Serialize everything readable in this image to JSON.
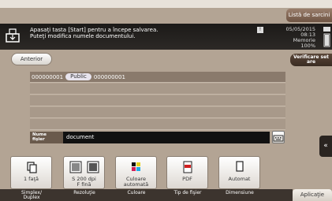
{
  "header": {
    "jobs_tab_label": "Listă de sarcini",
    "message_line1": "Apasaţi tasta [Start] pentru a începe salvarea.",
    "message_line2": "Puteţi modifica numele documentului.",
    "date": "05/05/2015",
    "time": "08:13",
    "memory_label": "Memorie",
    "memory_value": "100%"
  },
  "nav": {
    "back_label": "Anterior",
    "check_settings_label_1": "Verificare set",
    "check_settings_label_2": "are"
  },
  "destination": {
    "row_prefix": "000000001",
    "box_type": "Public",
    "row_suffix": "000000001"
  },
  "document_name": {
    "label_1": "Nume",
    "label_2": "fişier",
    "value": "document"
  },
  "functions": [
    {
      "icon": "single-sided-icon",
      "line1": "1 faţă",
      "line2": "",
      "caption_1": "Simplex/",
      "caption_2": "Duplex"
    },
    {
      "icon": "resolution-icon",
      "line1": "S 200 dpi",
      "line2": "F fină",
      "caption_1": "Rezoluţie",
      "caption_2": ""
    },
    {
      "icon": "color-icon",
      "line1": "Culoare",
      "line2": "automată",
      "caption_1": "Culoare",
      "caption_2": ""
    },
    {
      "icon": "pdf-file-icon",
      "line1": "PDF",
      "line2": "",
      "caption_1": "Tip de fişier",
      "caption_2": ""
    },
    {
      "icon": "paper-size-icon",
      "line1": "Automat",
      "line2": "",
      "caption_1": "Dimensiune",
      "caption_2": ""
    }
  ],
  "footer": {
    "app_tab_label": "Aplicaţie"
  },
  "colors": {
    "background": "#b3a494",
    "message_bar": "#1c1a18",
    "tab_brown": "#6e5443"
  }
}
